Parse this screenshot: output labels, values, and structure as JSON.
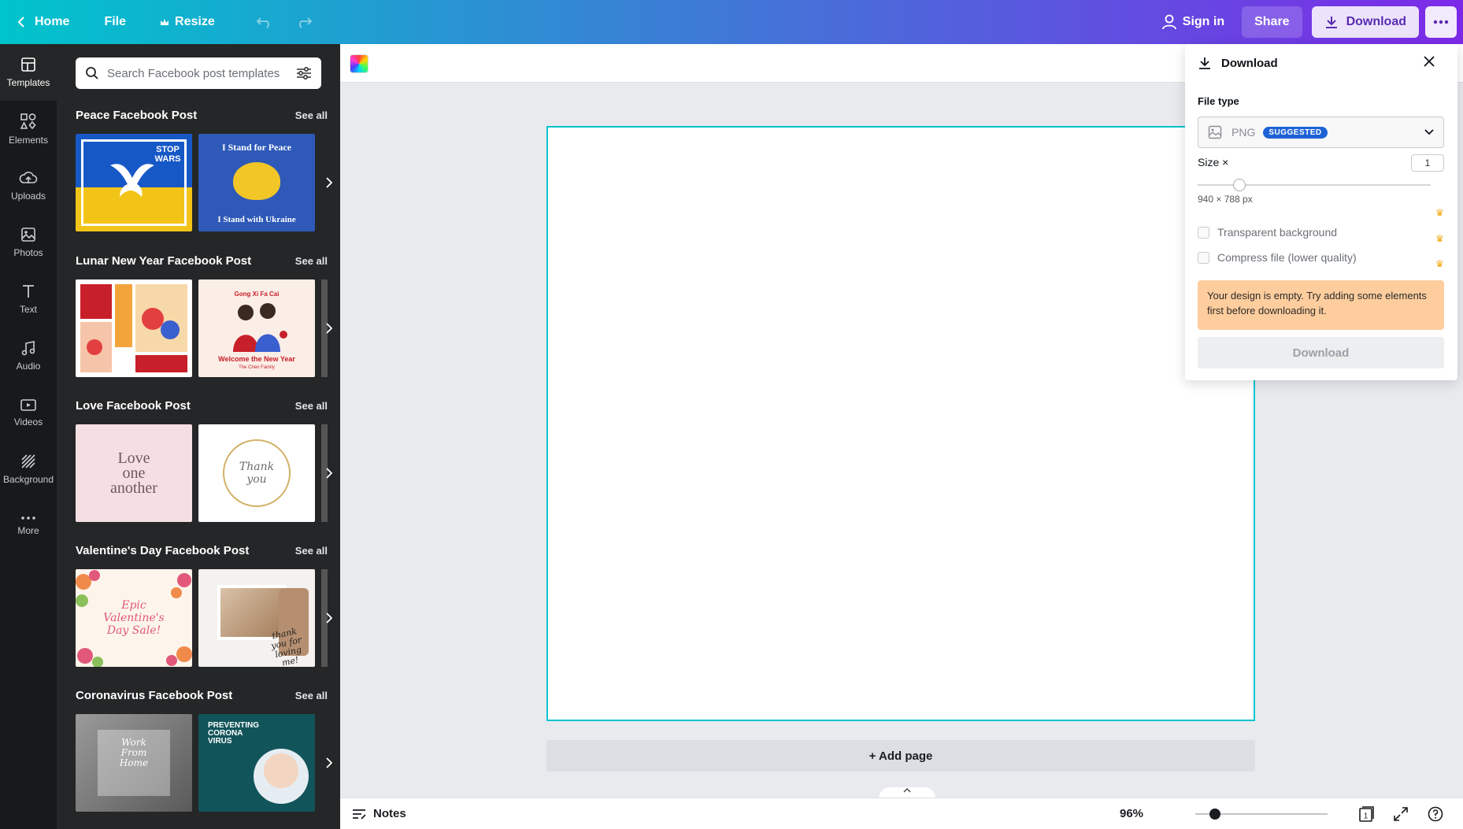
{
  "topbar": {
    "home_label": "Home",
    "file_label": "File",
    "resize_label": "Resize",
    "signin_label": "Sign in",
    "share_label": "Share",
    "download_label": "Download"
  },
  "rail": {
    "items": [
      {
        "label": "Templates",
        "icon": "layout-icon"
      },
      {
        "label": "Elements",
        "icon": "shapes-icon"
      },
      {
        "label": "Uploads",
        "icon": "cloud-upload-icon"
      },
      {
        "label": "Photos",
        "icon": "image-icon"
      },
      {
        "label": "Text",
        "icon": "text-icon"
      },
      {
        "label": "Audio",
        "icon": "music-icon"
      },
      {
        "label": "Videos",
        "icon": "video-icon"
      },
      {
        "label": "Background",
        "icon": "pattern-icon"
      },
      {
        "label": "More",
        "icon": "dots-icon"
      }
    ]
  },
  "panel": {
    "search_placeholder": "Search Facebook post templates",
    "see_all": "See all",
    "sections": [
      {
        "title": "Peace Facebook Post"
      },
      {
        "title": "Lunar New Year Facebook Post"
      },
      {
        "title": "Love Facebook Post"
      },
      {
        "title": "Valentine's Day Facebook Post"
      },
      {
        "title": "Coronavirus Facebook Post"
      }
    ],
    "thumbs": {
      "peace1_text": "STOP WARS",
      "peace2_top": "I Stand for Peace",
      "peace2_bottom": "I Stand with Ukraine",
      "lunar2_top": "Gong Xi Fa Cai",
      "lunar2_bottom": "Welcome the New Year",
      "lunar2_sub": "The Chen Family",
      "love1_text": "Love one another",
      "love2_text": "Thank you",
      "val1_text": "Epic Valentine's Day Sale!",
      "val2_text": "thank you for loving me!",
      "cov1_text": "Work From Home",
      "cov2_text": "PREVENTING CORONA VIRUS"
    }
  },
  "canvas": {
    "add_page_label": "+ Add page"
  },
  "bottombar": {
    "notes_label": "Notes",
    "zoom_value": "96%",
    "zoom_fraction": 0.15,
    "page_count": "1"
  },
  "download_panel": {
    "title": "Download",
    "file_type_label": "File type",
    "file_type_value": "PNG",
    "suggested_badge": "SUGGESTED",
    "size_label": "Size ×",
    "size_value": "1",
    "size_fraction": 0.18,
    "dimensions": "940 × 788 px",
    "transparent_label": "Transparent background",
    "compress_label": "Compress file (lower quality)",
    "warning": "Your design is empty. Try adding some elements first before downloading it.",
    "download_button": "Download"
  },
  "colors": {
    "brand_gradient_start": "#00c4cc",
    "brand_gradient_end": "#7d2ae8",
    "selection": "#00c4cc",
    "warning_bg": "#fecd9e",
    "badge": "#1f62d6"
  }
}
